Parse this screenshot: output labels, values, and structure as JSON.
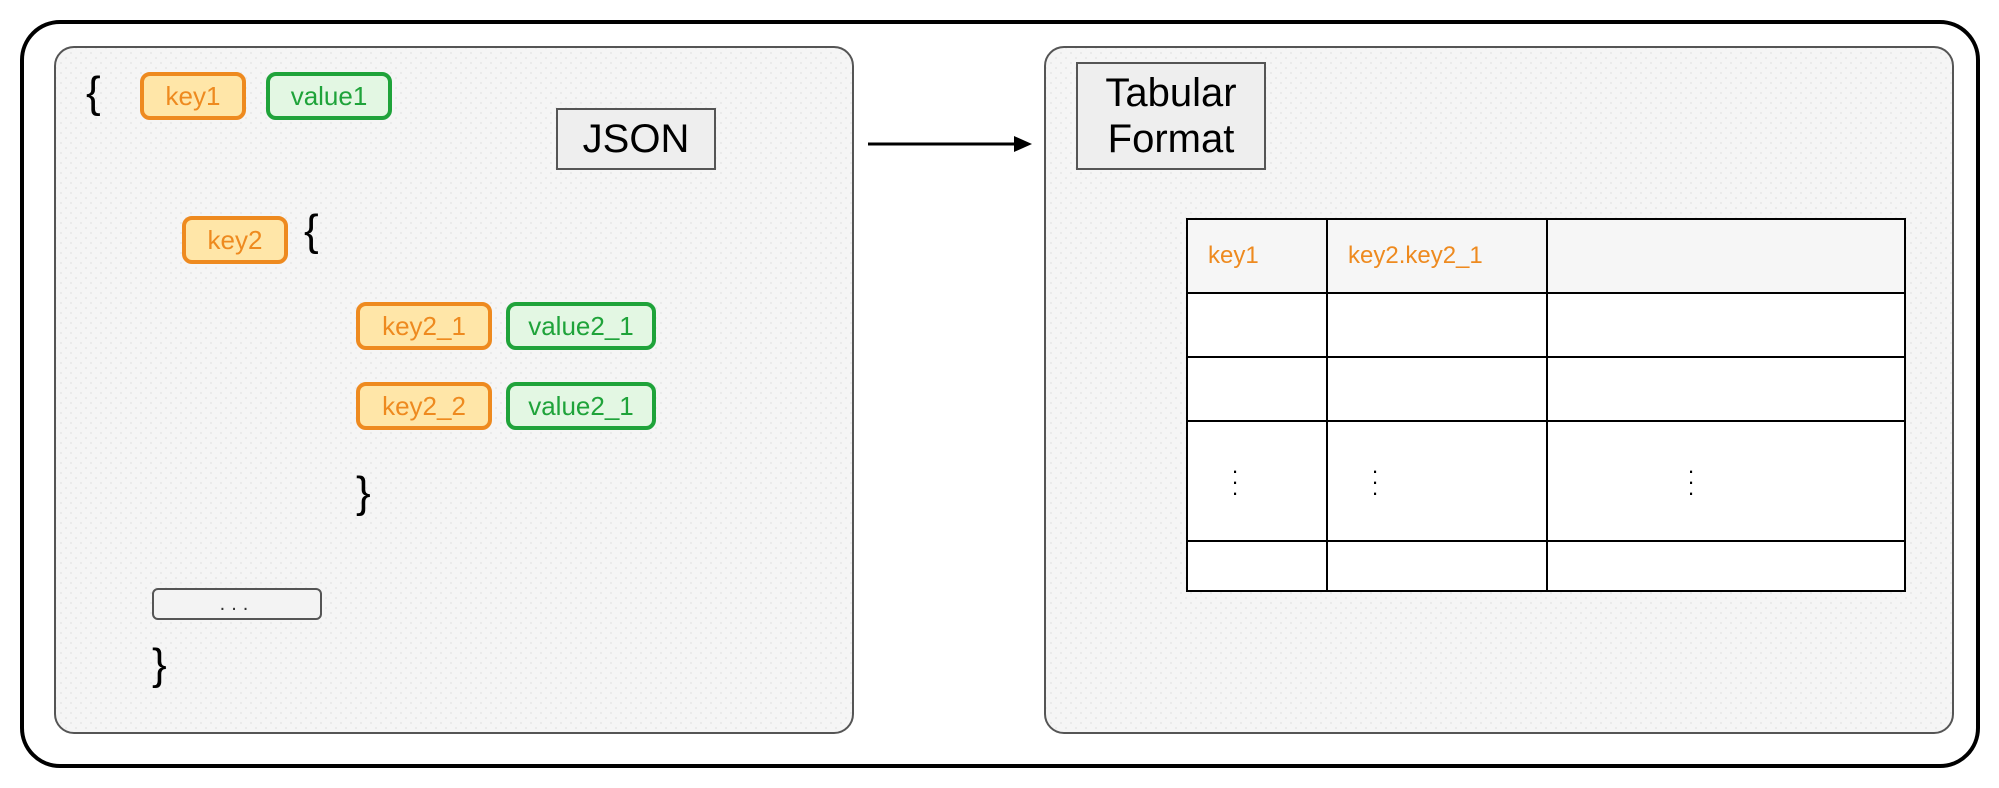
{
  "json_panel": {
    "title": "JSON",
    "braces": {
      "open": "{",
      "close": "}"
    },
    "key1": "key1",
    "value1": "value1",
    "key2": "key2",
    "key2_1": "key2_1",
    "value2_1": "value2_1",
    "key2_2": "key2_2",
    "value2_2": "value2_1",
    "ellipsis": "..."
  },
  "tabular_panel": {
    "title": "Tabular\nFormat",
    "headers": {
      "col1": "key1",
      "col2": "key2.key2_1",
      "col3": ""
    },
    "vdots": "⋮"
  }
}
